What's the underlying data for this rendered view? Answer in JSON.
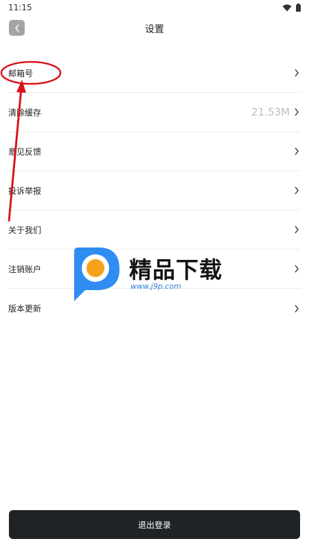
{
  "status_bar": {
    "time": "11:15"
  },
  "header": {
    "title": "设置"
  },
  "settings": [
    {
      "label": "邮箱号",
      "value": ""
    },
    {
      "label": "清除缓存",
      "value": "21.53M"
    },
    {
      "label": "意见反馈",
      "value": ""
    },
    {
      "label": "投诉举报",
      "value": ""
    },
    {
      "label": "关于我们",
      "value": ""
    },
    {
      "label": "注销账户",
      "value": ""
    },
    {
      "label": "版本更新",
      "value": ""
    }
  ],
  "logout": {
    "label": "退出登录"
  },
  "watermark": {
    "brand": "精品下载",
    "url": "www.j9p.com"
  },
  "icons": {
    "back": "chevron-left-icon",
    "chevron": "chevron-right-icon",
    "wifi": "wifi-icon",
    "battery": "battery-icon"
  },
  "colors": {
    "logout_bg": "#1f2326",
    "annotation": "#d9141f",
    "watermark_blue": "#2f8cf0",
    "watermark_orange": "#f7a11a"
  }
}
